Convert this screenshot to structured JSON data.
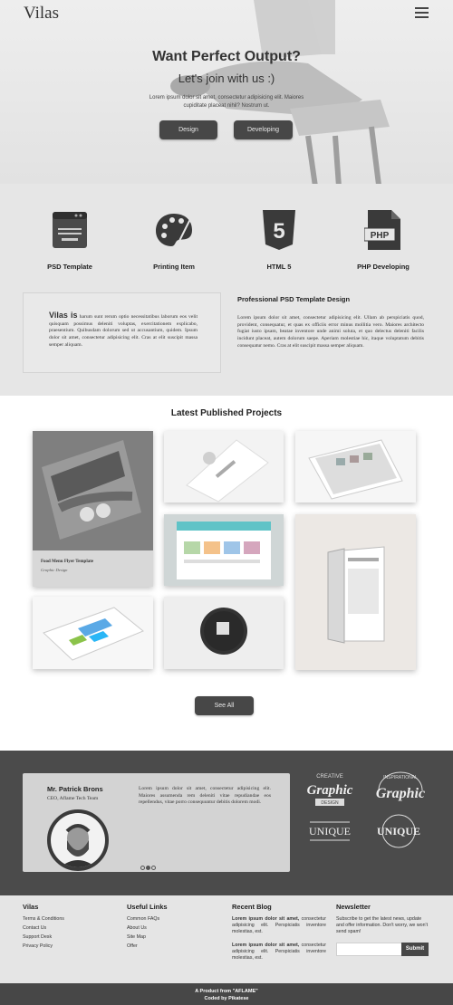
{
  "brand": {
    "logo": "Vilas"
  },
  "hero": {
    "title": "Want Perfect Output?",
    "subtitle": "Let's join with us :)",
    "description": "Lorem ipsum dolor sit amet, consectetur adipisicing elit. Maiores cupiditate placeat nihil? Nostrum ut.",
    "buttons": [
      "Design",
      "Developing"
    ]
  },
  "services": [
    {
      "label": "PSD Template",
      "icon": "browser-window-icon"
    },
    {
      "label": "Printing Item",
      "icon": "paint-palette-icon"
    },
    {
      "label": "HTML 5",
      "icon": "html5-shield-icon",
      "badge": "5"
    },
    {
      "label": "PHP Developing",
      "icon": "php-file-icon",
      "badge": "PHP"
    }
  ],
  "about": {
    "lead": "Vilas is",
    "text": "harum sunt rerum optio necessitatibus laborum eos velit quisquam possimus deleniti voluptas, exercitationem explicabo, praesentium. Quibusdam dolorum sed ut accusantium, quidem. Ipsum dolor sit amet, consectetur adipisicing elit. Cras at elit suscipit massa semper aliquam.",
    "title": "Professional PSD Template Design",
    "body": "Lorem ipsum dolor sit amet, consectetur adipisicing elit. Ullam ab perspiciatis quod, provident, consequatur, et quas ex officiis error minus mollitia vero. Maiores architecto fugiat iusto ipsam, beatae inventore unde animi soluta, et quo delectus deleniti facilis incidunt placeat, autem dolorum saepe. Aperiam molestiae hic, itaque voluptatum debitis consequatur nemo. Cras at elit suscipit massa semper aliquam."
  },
  "projects": {
    "title": "Latest Published Projects",
    "featured": {
      "name": "Food Menu Flyer Template",
      "category": "Graphic Design"
    },
    "see_all": "See All"
  },
  "testimonial": {
    "name": "Mr. Patrick Brons",
    "role": "CEO, Aflame Tech Team",
    "quote": "Lorem ipsum dolor sit amet, consectetur adipisicing elit. Maiores assumenda rem deleniti vitae repudiandae eos repellendus, vitae porro consequuntur debitis dolorem modi.",
    "dots": 3,
    "active_dot": 2,
    "badges": [
      {
        "top": "CREATIVE",
        "main": "Graphic",
        "bottom": "DESIGN"
      },
      {
        "top": "INSPIRATIONAL",
        "main": "Graphic",
        "bottom": ""
      },
      {
        "top": "",
        "main": "UNIQUE",
        "bottom": ""
      },
      {
        "top": "",
        "main": "UNIQUE",
        "bottom": ""
      }
    ]
  },
  "footer": {
    "col1": {
      "title": "Vilas",
      "links": [
        "Terms & Conditions",
        "Contact Us",
        "Support Desk",
        "Privacy Policy"
      ]
    },
    "col2": {
      "title": "Useful Links",
      "links": [
        "Common FAQs",
        "About Us",
        "Site Map",
        "Offer"
      ]
    },
    "col3": {
      "title": "Recent Blog",
      "posts": [
        {
          "lead": "Lorem ipsum dolor sit amet,",
          "text": "consectetur adipisicing elit. Perspiciatis inventore molestias, est."
        },
        {
          "lead": "Lorem ipsum dolor sit amet,",
          "text": "consectetur adipisicing elit. Perspiciatis inventore molestias, est."
        }
      ]
    },
    "col4": {
      "title": "Newsletter",
      "text": "Subscribe to get the latest news, update and offer information. Don't worry, we won't send spam!",
      "placeholder": "",
      "button": "Submit"
    },
    "credit_line1": "A Product from \"AFLAME\"",
    "credit_line2": "Coded by Pikatese"
  },
  "colors": {
    "dark": "#474747",
    "testimonial_bg": "#4b4b4b",
    "light_bg": "#e6e6e6"
  }
}
